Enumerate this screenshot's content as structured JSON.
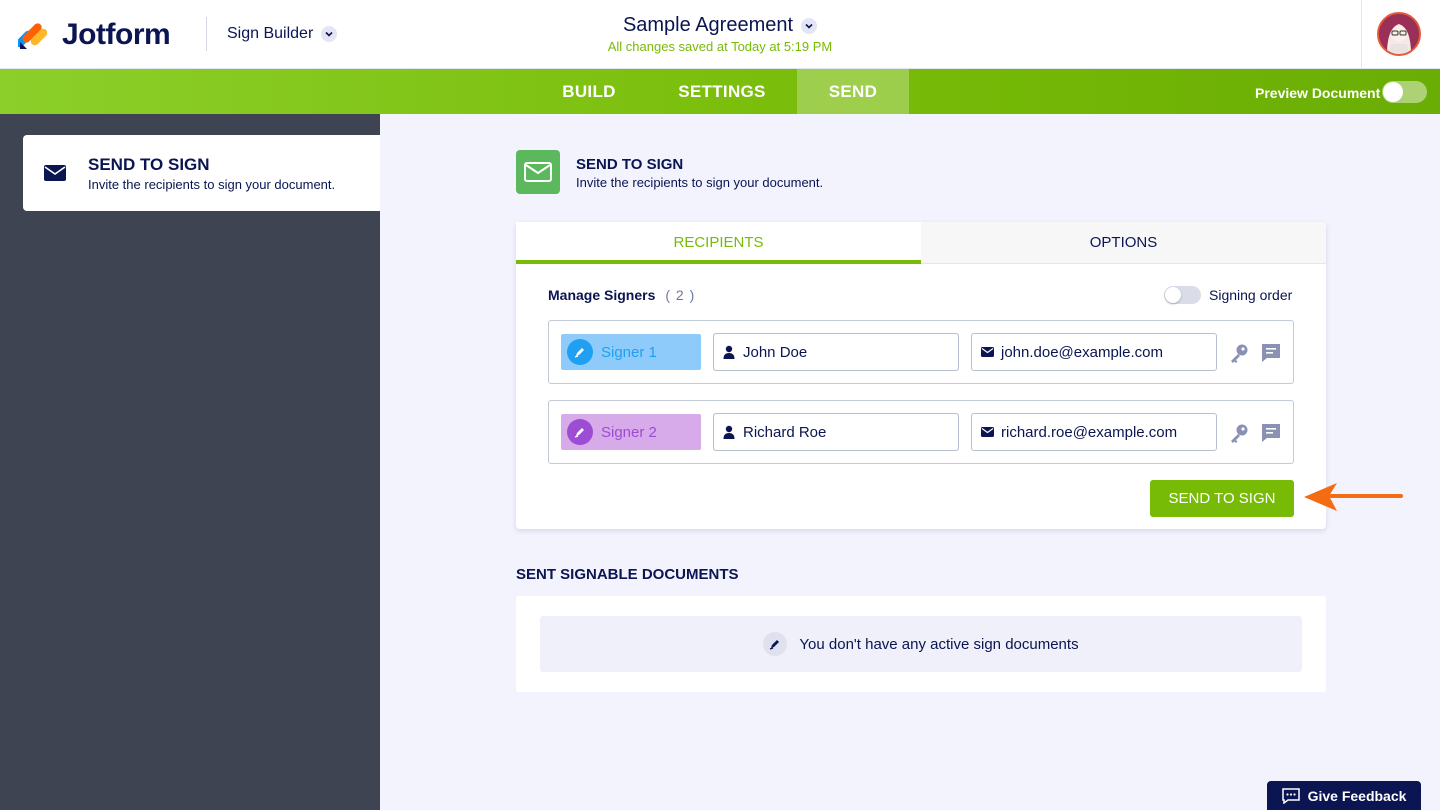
{
  "app": {
    "brand": "Jotform",
    "builder_label": "Sign Builder"
  },
  "document": {
    "title": "Sample Agreement",
    "save_status": "All changes saved at Today at 5:19 PM"
  },
  "nav": {
    "tabs": [
      {
        "label": "BUILD",
        "active": false
      },
      {
        "label": "SETTINGS",
        "active": false
      },
      {
        "label": "SEND",
        "active": true
      }
    ],
    "preview_label": "Preview Document",
    "preview_enabled": false
  },
  "sidebar": {
    "items": [
      {
        "title": "SEND TO SIGN",
        "subtitle": "Invite the recipients to sign your document."
      }
    ]
  },
  "main": {
    "section_title": "SEND TO SIGN",
    "section_subtitle": "Invite the recipients to sign your document.",
    "tabs": [
      {
        "label": "RECIPIENTS",
        "active": true
      },
      {
        "label": "OPTIONS",
        "active": false
      }
    ],
    "manage_label": "Manage Signers",
    "signer_count": "( 2 )",
    "signing_order_label": "Signing order",
    "signing_order_enabled": false,
    "signers": [
      {
        "label": "Signer 1",
        "name": "John Doe",
        "email": "john.doe@example.com",
        "color": "#8ecbfb",
        "accent": "#1fa0f2"
      },
      {
        "label": "Signer 2",
        "name": "Richard Roe",
        "email": "richard.roe@example.com",
        "color": "#d7aae9",
        "accent": "#9c4dd3"
      }
    ],
    "send_button": "SEND TO SIGN"
  },
  "sent": {
    "title": "SENT SIGNABLE DOCUMENTS",
    "empty_message": "You don't have any active sign documents"
  },
  "feedback": {
    "label": "Give Feedback"
  },
  "colors": {
    "brand_green": "#78bb07",
    "navy": "#0a1551",
    "sidebar_bg": "#3e4452",
    "arrow": "#f36b12"
  }
}
